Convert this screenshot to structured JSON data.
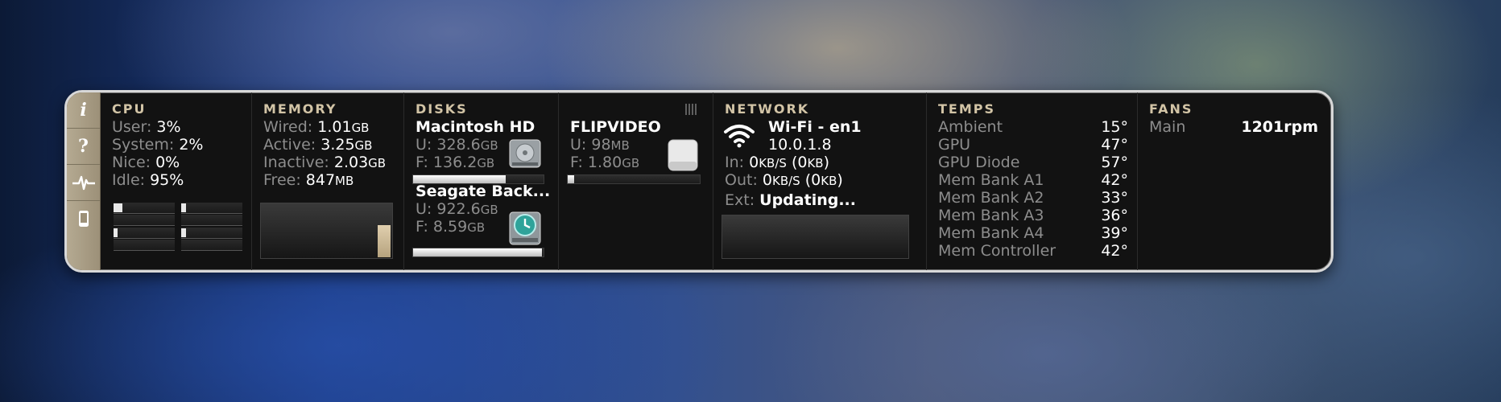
{
  "colors": {
    "header": "#d2c4a6",
    "label": "#8d8d8d",
    "value": "#ffffff",
    "sidebar": "#b5aa92"
  },
  "sidebar": [
    {
      "name": "info",
      "glyph": "i"
    },
    {
      "name": "help",
      "glyph": "?"
    },
    {
      "name": "activity",
      "icon": "pulse-icon"
    },
    {
      "name": "device",
      "icon": "phone-icon"
    }
  ],
  "cpu": {
    "header": "CPU",
    "rows": [
      {
        "label": "User:",
        "value": "3%"
      },
      {
        "label": "System:",
        "value": "2%"
      },
      {
        "label": "Nice:",
        "value": "0%"
      },
      {
        "label": "Idle:",
        "value": "95%"
      }
    ],
    "core_bars": [
      0.14,
      0.08,
      0.07,
      0.08
    ]
  },
  "memory": {
    "header": "MEMORY",
    "rows": [
      {
        "label": "Wired:",
        "value": "1.01",
        "unit": "GB"
      },
      {
        "label": "Active:",
        "value": "3.25",
        "unit": "GB"
      },
      {
        "label": "Inactive:",
        "value": "2.03",
        "unit": "GB"
      },
      {
        "label": "Free:",
        "value": "847",
        "unit": "MB"
      }
    ]
  },
  "disks": {
    "header": "DISKS",
    "items": [
      {
        "name": "Macintosh HD",
        "used_label": "U:",
        "used": "328.6",
        "used_unit": "GB",
        "free_label": "F:",
        "free": "136.2",
        "free_unit": "GB",
        "icon": "hard-disk-icon",
        "usage": 0.71
      },
      {
        "name": "Seagate Back...",
        "used_label": "U:",
        "used": "922.6",
        "used_unit": "GB",
        "free_label": "F:",
        "free": "8.59",
        "free_unit": "GB",
        "icon": "time-machine-icon",
        "usage": 0.99
      }
    ]
  },
  "flipvideo": {
    "name": "FLIPVIDEO",
    "used_label": "U:",
    "used": "98",
    "used_unit": "MB",
    "free_label": "F:",
    "free": "1.80",
    "free_unit": "GB",
    "icon": "external-drive-icon",
    "usage": 0.05
  },
  "network": {
    "header": "NETWORK",
    "interface": "Wi-Fi - en1",
    "ip": "10.0.1.8",
    "in_label": "In:",
    "in_value": "0",
    "in_unit": "KB/S",
    "in_peak": "(0",
    "in_peak_unit": "KB",
    "in_close": ")",
    "out_label": "Out:",
    "out_value": "0",
    "out_unit": "KB/S",
    "out_peak": "(0",
    "out_peak_unit": "KB",
    "out_close": ")",
    "ext_label": "Ext:",
    "ext_value": "Updating..."
  },
  "temps": {
    "header": "TEMPS",
    "rows": [
      {
        "label": "Ambient",
        "value": "15°"
      },
      {
        "label": "GPU",
        "value": "47°"
      },
      {
        "label": "GPU Diode",
        "value": "57°"
      },
      {
        "label": "Mem Bank A1",
        "value": "42°"
      },
      {
        "label": "Mem Bank A2",
        "value": "33°"
      },
      {
        "label": "Mem Bank A3",
        "value": "36°"
      },
      {
        "label": "Mem Bank A4",
        "value": "39°"
      },
      {
        "label": "Mem Controller",
        "value": "42°"
      }
    ]
  },
  "fans": {
    "header": "FANS",
    "rows": [
      {
        "label": "Main",
        "value": "1201rpm"
      }
    ]
  }
}
